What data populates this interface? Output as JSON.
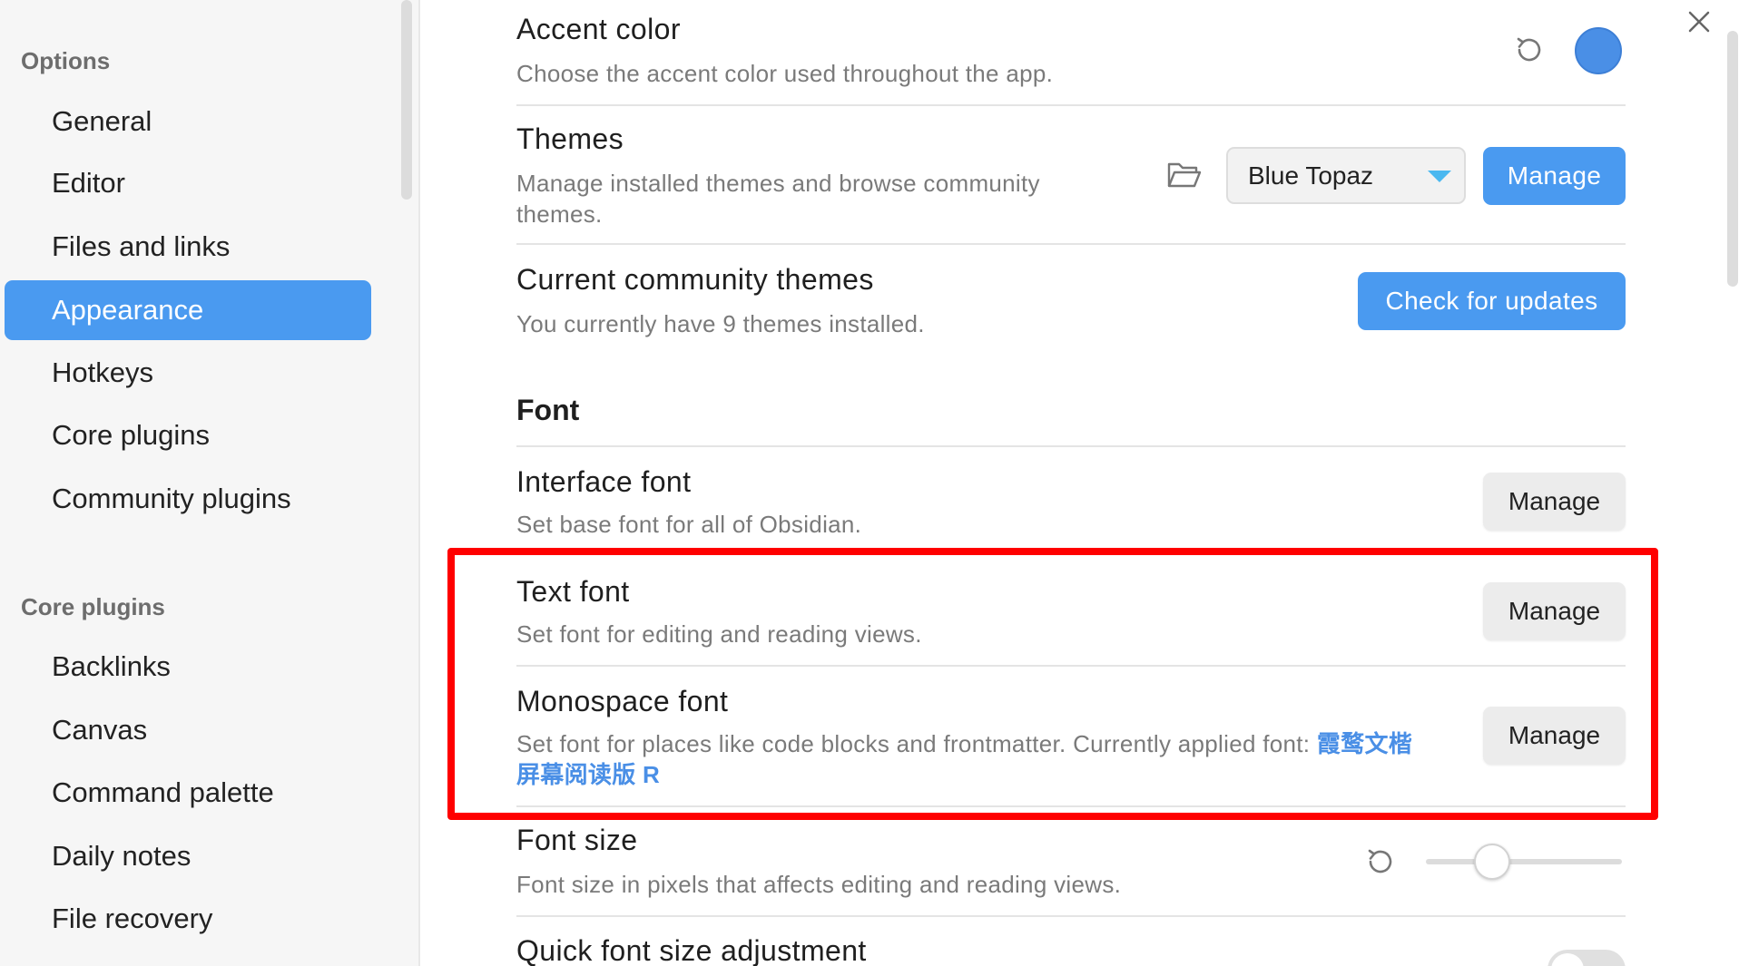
{
  "sidebar": {
    "options_title": "Options",
    "options_items": [
      {
        "label": "General"
      },
      {
        "label": "Editor"
      },
      {
        "label": "Files and links"
      },
      {
        "label": "Appearance"
      },
      {
        "label": "Hotkeys"
      },
      {
        "label": "Core plugins"
      },
      {
        "label": "Community plugins"
      }
    ],
    "core_title": "Core plugins",
    "core_items": [
      {
        "label": "Backlinks"
      },
      {
        "label": "Canvas"
      },
      {
        "label": "Command palette"
      },
      {
        "label": "Daily notes"
      },
      {
        "label": "File recovery"
      }
    ]
  },
  "settings": {
    "accent": {
      "title": "Accent color",
      "desc": "Choose the accent color used throughout the app.",
      "color": "#4a8fe6"
    },
    "themes": {
      "title": "Themes",
      "desc_line1": "Manage installed themes and browse community",
      "desc_line2": "themes.",
      "selected": "Blue Topaz",
      "manage_label": "Manage"
    },
    "community_themes": {
      "title": "Current community themes",
      "desc": "You currently have 9 themes installed.",
      "button_label": "Check for updates"
    },
    "font_heading": "Font",
    "interface_font": {
      "title": "Interface font",
      "desc": "Set base font for all of Obsidian.",
      "manage_label": "Manage"
    },
    "text_font": {
      "title": "Text font",
      "desc": "Set font for editing and reading views.",
      "manage_label": "Manage"
    },
    "monospace_font": {
      "title": "Monospace font",
      "desc": "Set font for places like code blocks and frontmatter. Currently applied font:",
      "font_name_line1": "霞鹜文楷",
      "font_name_line2": "屏幕阅读版 R",
      "manage_label": "Manage"
    },
    "font_size": {
      "title": "Font size",
      "desc": "Font size in pixels that affects editing and reading views.",
      "value_fraction": 0.34
    },
    "quick_font": {
      "title": "Quick font size adjustment"
    }
  },
  "colors": {
    "accent": "#4a9af0",
    "highlight": "#ff0000"
  }
}
